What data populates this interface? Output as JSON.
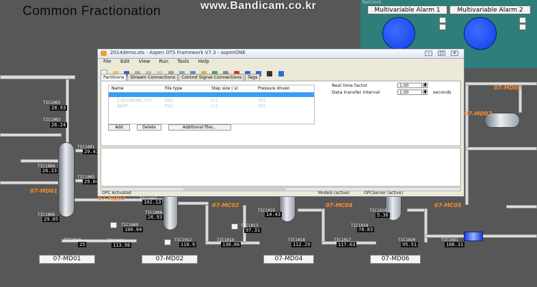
{
  "background": {
    "title": "Common Fractionation",
    "watermark": "www.Bandicam.co.kr",
    "unit_labels": [
      "07-MD08",
      "07-MD07",
      "07-MD01",
      "07-MD02",
      "07-MC02",
      "07-MC04",
      "07-MC05"
    ],
    "bottom_labels": [
      "07-MD01",
      "07-MD02",
      "07-MD04",
      "07-MD06"
    ],
    "readouts": [
      {
        "name": "TIC1002",
        "value": "28.93"
      },
      {
        "name": "TIC1003",
        "value": "26.24"
      },
      {
        "name": "TIC1001",
        "value": "29.41"
      },
      {
        "name": "TIC1004",
        "value": "26.23"
      },
      {
        "name": "TIC1005",
        "value": "29.04"
      },
      {
        "name": "TIC1006",
        "value": "29.05"
      },
      {
        "name": "TIC1007",
        "value": "102.13"
      },
      {
        "name": "TIC1008",
        "value": "26.93"
      },
      {
        "name": "TIC1009",
        "value": "100.04"
      },
      {
        "name": "TIC1010",
        "value": "25"
      },
      {
        "name": "TIC1011",
        "value": "113.96"
      },
      {
        "name": "TIC1012",
        "value": "118.9"
      },
      {
        "name": "TIC1013",
        "value": "97.31"
      },
      {
        "name": "TIC1014",
        "value": "130.86"
      },
      {
        "name": "TIC1015",
        "value": "14.43"
      },
      {
        "name": "TIC1016",
        "value": "112.29"
      },
      {
        "name": "TIC1017",
        "value": "117.63"
      },
      {
        "name": "TIC1018",
        "value": "78.83"
      },
      {
        "name": "TIC1019",
        "value": "5.36"
      },
      {
        "name": "TIC1020",
        "value": "95.51"
      },
      {
        "name": "TIC1021",
        "value": "108.31"
      }
    ]
  },
  "alarm_panel": {
    "caption": "TestClock",
    "alarm1": "Multivariable Alarm 1",
    "alarm2": "Multivariable Alarm 2",
    "lamp_color": "#1d4cf0"
  },
  "window": {
    "title": "2014demo.ots - Aspen OTS Framework V7.3 - aspenONE",
    "menu": [
      "File",
      "Edit",
      "View",
      "Run",
      "Tools",
      "Help"
    ],
    "tabs": [
      "Partitions",
      "Stream Connections",
      "Control Signal Connections",
      "Tags"
    ],
    "grid": {
      "headers": [
        "Name",
        "File type",
        "Step size ( s)",
        "Pressure driven"
      ],
      "rows": [
        [
          "2-DCOM.PAC.TXT",
          "RSC",
          "0.5",
          "YES"
        ],
        [
          "BASP",
          "RSC",
          "0.5",
          "YES"
        ]
      ]
    },
    "buttons": {
      "add": "Add",
      "delete": "Delete",
      "additional": "Additional files..."
    },
    "realtime_label": "Real time factor",
    "realtime_value": "1.00",
    "transfer_label": "Data transfer interval",
    "transfer_value": "1.00",
    "transfer_unit": "seconds",
    "status": {
      "left": "OPC Activated",
      "middle": "Models (active)",
      "right": "OPCServer (active)"
    }
  }
}
